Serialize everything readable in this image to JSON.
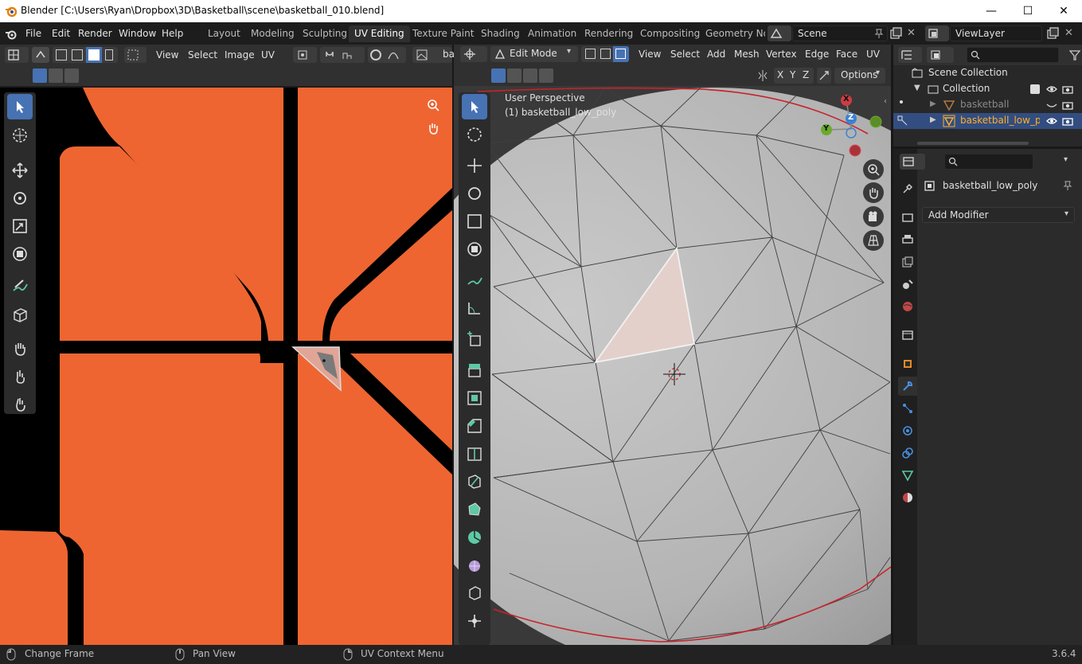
{
  "window": {
    "title": "Blender [C:\\Users\\Ryan\\Dropbox\\3D\\Basketball\\scene\\basketball_010.blend]",
    "minimize": "—",
    "maximize": "☐",
    "close": "✕"
  },
  "menu": [
    "File",
    "Edit",
    "Render",
    "Window",
    "Help"
  ],
  "workspaces": [
    "Layout",
    "Modeling",
    "Sculpting",
    "UV Editing",
    "Texture Paint",
    "Shading",
    "Animation",
    "Rendering",
    "Compositing",
    "Geometry No"
  ],
  "active_workspace": "UV Editing",
  "scene": "Scene",
  "view_layer": "ViewLayer",
  "uv_editor": {
    "menus": [
      "View",
      "Select",
      "Image",
      "UV"
    ],
    "image_name": "ba"
  },
  "viewport": {
    "mode": "Edit Mode",
    "menus": [
      "View",
      "Select",
      "Add",
      "Mesh",
      "Vertex",
      "Edge",
      "Face",
      "UV"
    ],
    "axes": [
      "X",
      "Y",
      "Z"
    ],
    "options": "Options",
    "perspective": "User Perspective",
    "object_label": "(1) basketball_low_poly",
    "gizmo": {
      "x": "X",
      "y": "Y",
      "z": "Z"
    }
  },
  "outliner": {
    "root": "Scene Collection",
    "collection": "Collection",
    "items": [
      {
        "name": "basketball"
      },
      {
        "name": "basketball_low_p"
      }
    ]
  },
  "properties": {
    "object": "basketball_low_poly",
    "add_modifier": "Add Modifier"
  },
  "status": {
    "left": "Change Frame",
    "middle": "Pan View",
    "right": "UV Context Menu",
    "version": "3.6.4"
  },
  "colors": {
    "orange": "#ee6531",
    "accent": "#4772b3",
    "selected_text": "#ffaf29",
    "seam": "#e02c2c"
  }
}
